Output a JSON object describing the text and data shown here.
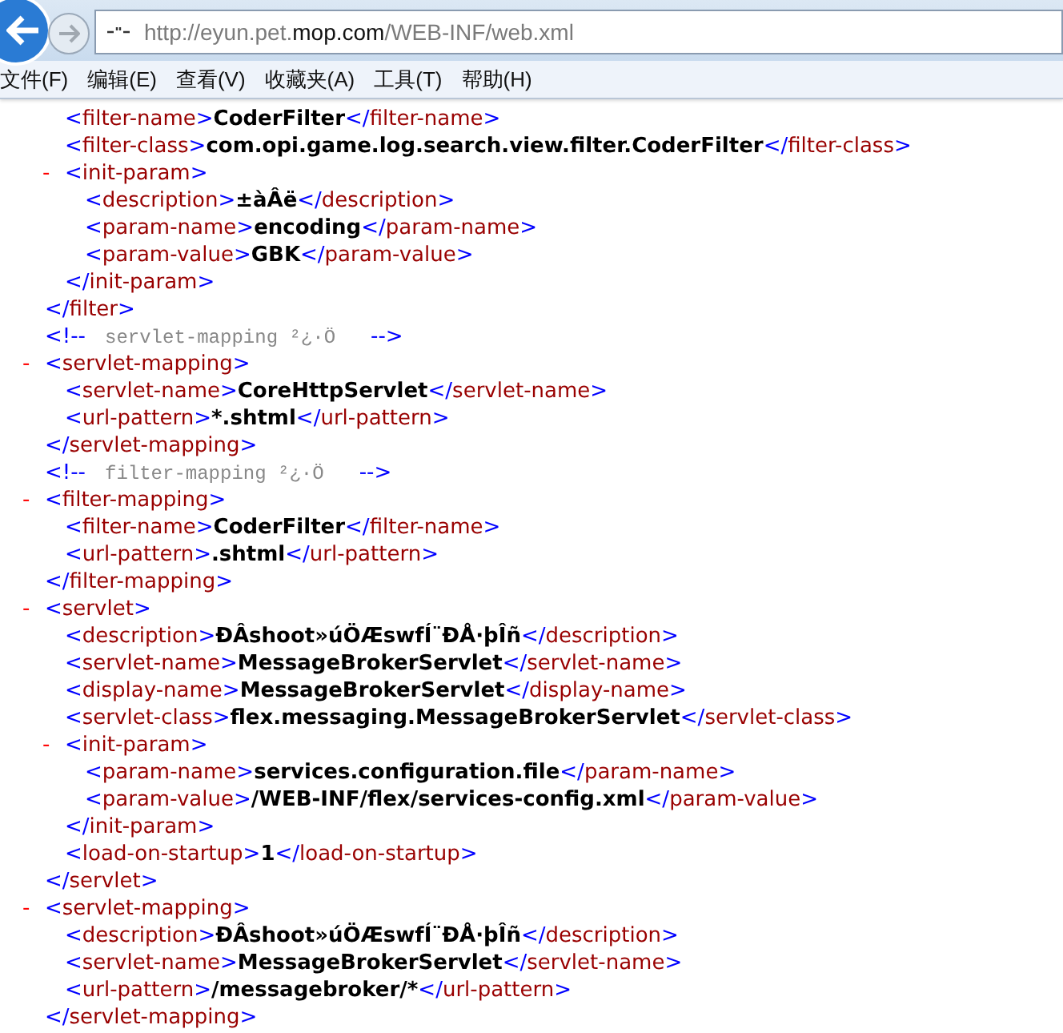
{
  "toolbar": {
    "back_button": {
      "disabled": false
    },
    "forward_button": {
      "disabled": true
    },
    "address": {
      "prefix": "http://eyun.pet.",
      "domain": "mop.com",
      "path": "/WEB-INF/web.xml"
    }
  },
  "menu": [
    {
      "label": "文件(F)"
    },
    {
      "label": "编辑(E)"
    },
    {
      "label": "查看(V)"
    },
    {
      "label": "收藏夹(A)"
    },
    {
      "label": "工具(T)"
    },
    {
      "label": "帮助(H)"
    }
  ],
  "syntax": {
    "lt": "<",
    "gt": ">",
    "lt_slash": "</",
    "comment_start": "<!--",
    "comment_end": "-->"
  },
  "document": [
    {
      "kind": "partial",
      "end_tag": "filter",
      "children": [
        {
          "kind": "leaf",
          "tag": "filter-name",
          "value": "CoderFilter",
          "end_tag": "filter-name"
        },
        {
          "kind": "leaf",
          "tag": "filter-class",
          "value": "com.opi.game.log.search.view.filter.CoderFilter",
          "end_tag": "filter-class"
        },
        {
          "kind": "parent",
          "toggle": "-",
          "expanded": true,
          "tag": "init-param",
          "end_tag": "init-param",
          "children": [
            {
              "kind": "leaf",
              "tag": "description",
              "value": "±àÂë",
              "end_tag": "description"
            },
            {
              "kind": "leaf",
              "tag": "param-name",
              "value": "encoding",
              "end_tag": "param-name"
            },
            {
              "kind": "leaf",
              "tag": "param-value",
              "value": "GBK",
              "end_tag": "param-value"
            }
          ]
        }
      ]
    },
    {
      "kind": "comment",
      "text": "servlet-mapping ²¿·Ö"
    },
    {
      "kind": "parent",
      "toggle": "-",
      "expanded": true,
      "tag": "servlet-mapping",
      "end_tag": "servlet-mapping",
      "children": [
        {
          "kind": "leaf",
          "tag": "servlet-name",
          "value": "CoreHttpServlet",
          "end_tag": "servlet-name"
        },
        {
          "kind": "leaf",
          "tag": "url-pattern",
          "value": "*.shtml",
          "end_tag": "url-pattern"
        }
      ]
    },
    {
      "kind": "comment",
      "text": "filter-mapping ²¿·Ö"
    },
    {
      "kind": "parent",
      "toggle": "-",
      "expanded": true,
      "tag": "filter-mapping",
      "end_tag": "filter-mapping",
      "children": [
        {
          "kind": "leaf",
          "tag": "filter-name",
          "value": "CoderFilter",
          "end_tag": "filter-name"
        },
        {
          "kind": "leaf",
          "tag": "url-pattern",
          "value": ".shtml",
          "end_tag": "url-pattern"
        }
      ]
    },
    {
      "kind": "parent",
      "toggle": "-",
      "expanded": true,
      "tag": "servlet",
      "end_tag": "servlet",
      "children": [
        {
          "kind": "leaf",
          "tag": "description",
          "value": "ÐÂshoot»úÖÆswfÍ¨ÐÅ·þÎñ",
          "end_tag": "description"
        },
        {
          "kind": "leaf",
          "tag": "servlet-name",
          "value": "MessageBrokerServlet",
          "end_tag": "servlet-name"
        },
        {
          "kind": "leaf",
          "tag": "display-name",
          "value": "MessageBrokerServlet",
          "end_tag": "display-name"
        },
        {
          "kind": "leaf",
          "tag": "servlet-class",
          "value": "flex.messaging.MessageBrokerServlet",
          "end_tag": "servlet-class"
        },
        {
          "kind": "parent",
          "toggle": "-",
          "expanded": true,
          "tag": "init-param",
          "end_tag": "init-param",
          "children": [
            {
              "kind": "leaf",
              "tag": "param-name",
              "value": "services.configuration.file",
              "end_tag": "param-name"
            },
            {
              "kind": "leaf",
              "tag": "param-value",
              "value": "/WEB-INF/flex/services-config.xml",
              "end_tag": "param-value"
            }
          ]
        },
        {
          "kind": "leaf",
          "tag": "load-on-startup",
          "value": "1",
          "end_tag": "load-on-startup"
        }
      ]
    },
    {
      "kind": "parent",
      "toggle": "-",
      "expanded": true,
      "tag": "servlet-mapping",
      "end_tag": "servlet-mapping",
      "children": [
        {
          "kind": "leaf",
          "tag": "description",
          "value": "ÐÂshoot»úÖÆswfÍ¨ÐÅ·þÎñ",
          "end_tag": "description"
        },
        {
          "kind": "leaf",
          "tag": "servlet-name",
          "value": "MessageBrokerServlet",
          "end_tag": "servlet-name"
        },
        {
          "kind": "leaf",
          "tag": "url-pattern",
          "value": "/messagebroker/*",
          "end_tag": "url-pattern"
        }
      ]
    }
  ]
}
